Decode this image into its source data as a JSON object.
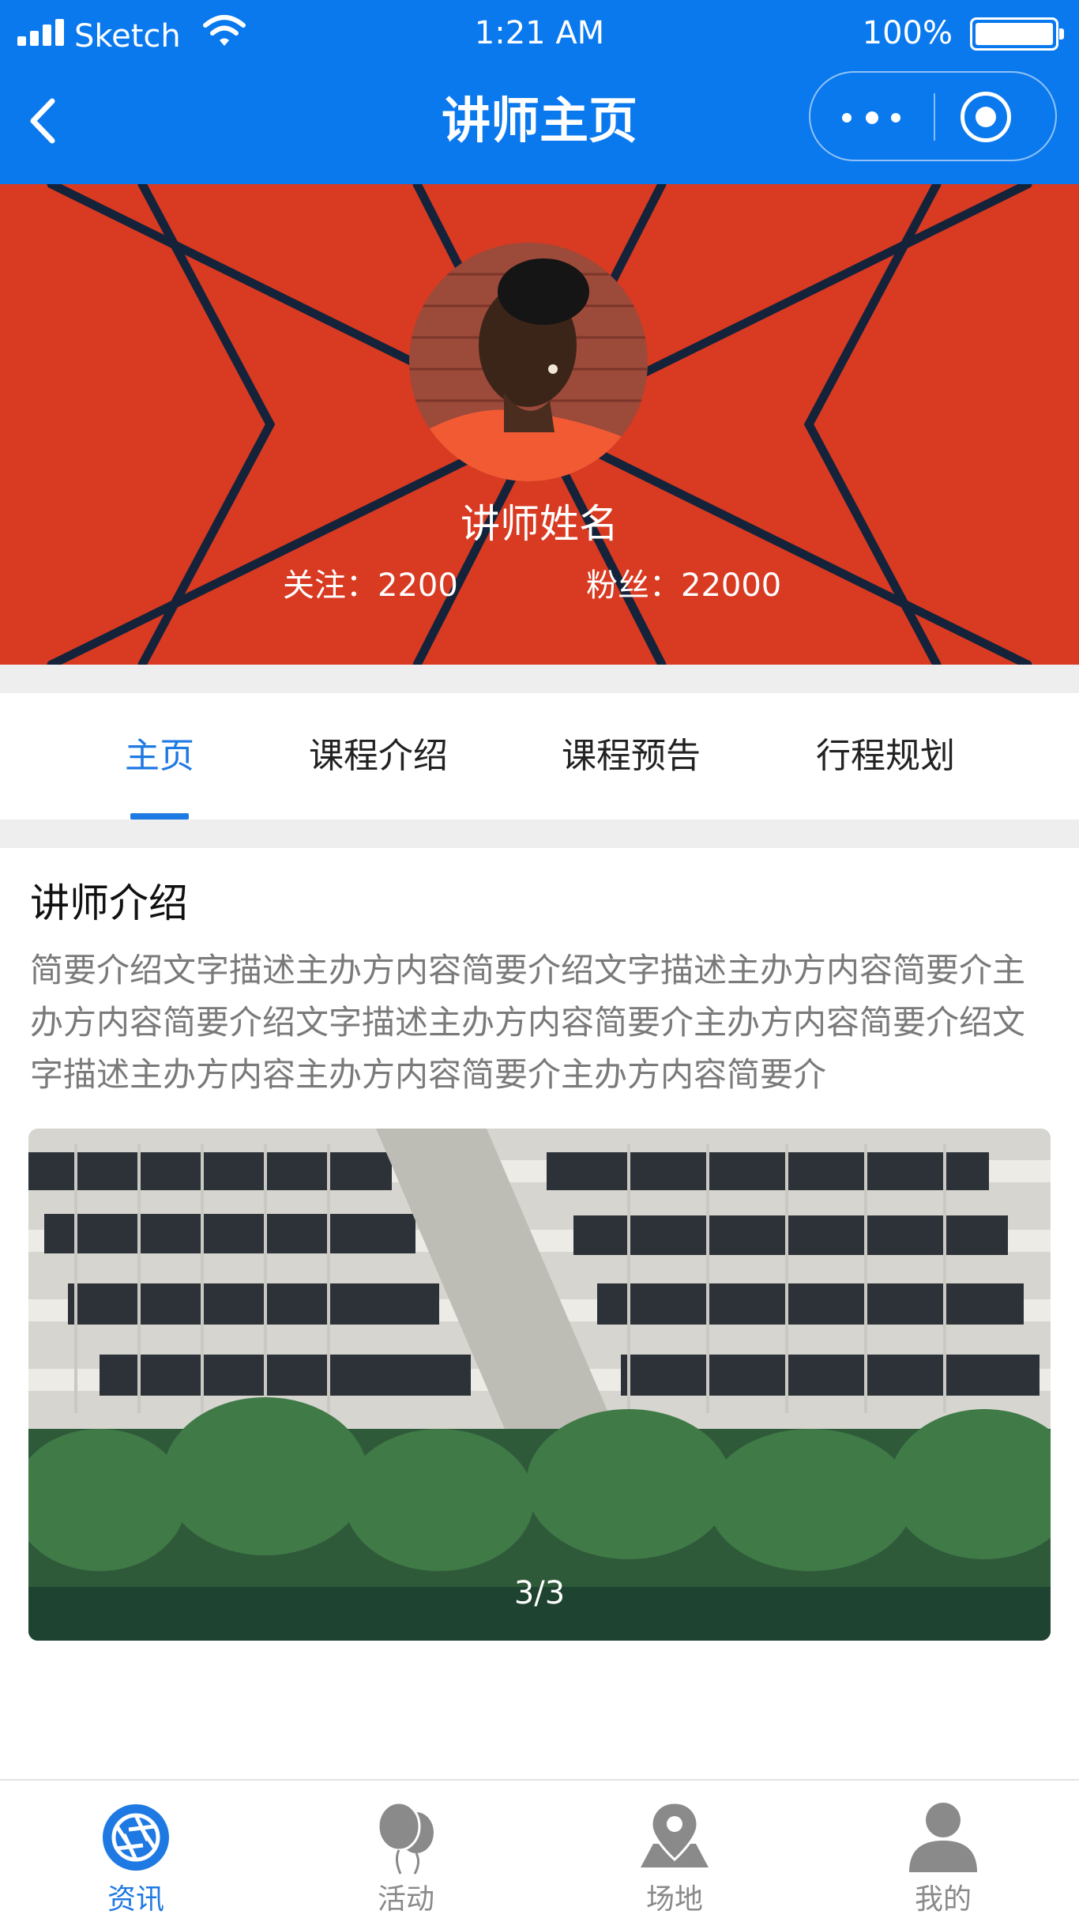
{
  "status_bar": {
    "carrier": "Sketch",
    "time": "1:21 AM",
    "battery": "100%"
  },
  "nav": {
    "title": "讲师主页"
  },
  "profile": {
    "name": "讲师姓名",
    "following": "关注：2200",
    "followers": "粉丝：22000"
  },
  "tabs": [
    {
      "label": "主页"
    },
    {
      "label": "课程介绍"
    },
    {
      "label": "课程预告"
    },
    {
      "label": "行程规划"
    }
  ],
  "section": {
    "title": "讲师介绍",
    "body": "简要介绍文字描述主办方内容简要介绍文字描述主办方内容简要介主办方内容简要介绍文字描述主办方内容简要介主办方内容简要介绍文字描述主办方内容主办方内容简要介主办方内容简要介"
  },
  "gallery": {
    "counter": "3/3"
  },
  "tab_bar": [
    {
      "label": "资讯",
      "icon": "aperture-icon"
    },
    {
      "label": "活动",
      "icon": "balloons-icon"
    },
    {
      "label": "场地",
      "icon": "map-pin-icon"
    },
    {
      "label": "我的",
      "icon": "user-icon"
    }
  ],
  "colors": {
    "nav_blue": "#0a79ee",
    "hero_red": "#d83a22",
    "accent_blue": "#1f79e3",
    "inactive_gray": "#8a8a8a"
  }
}
